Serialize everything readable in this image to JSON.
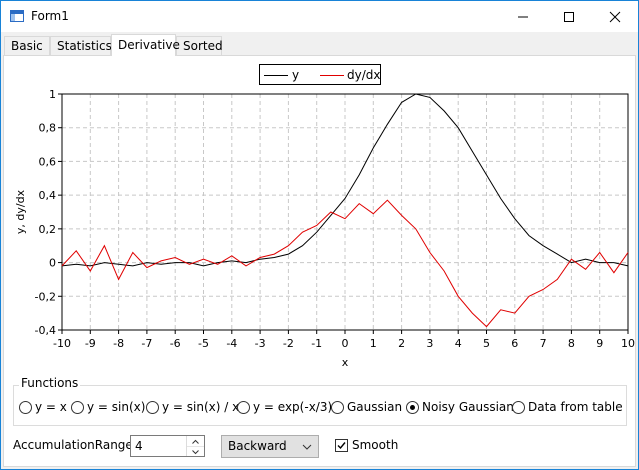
{
  "window": {
    "title": "Form1"
  },
  "tabs": [
    {
      "label": "Basic"
    },
    {
      "label": "Statistics"
    },
    {
      "label": "Derivative"
    },
    {
      "label": "Sorted"
    }
  ],
  "active_tab": "Derivative",
  "colors": {
    "y": "#000000",
    "dydx": "#e00000",
    "grid": "#c8c8c8",
    "accent": "#1883d7"
  },
  "chart_data": {
    "type": "line",
    "title": "",
    "xlabel": "x",
    "ylabel": "y, dy/dx",
    "xlim": [
      -10,
      10
    ],
    "ylim": [
      -0.4,
      1
    ],
    "x_ticks": [
      -10,
      -9,
      -8,
      -7,
      -6,
      -5,
      -4,
      -3,
      -2,
      -1,
      0,
      1,
      2,
      3,
      4,
      5,
      6,
      7,
      8,
      9,
      10
    ],
    "x_tick_labels": [
      "-10",
      "-9",
      "-8",
      "-7",
      "-6",
      "-5",
      "-4",
      "-3",
      "-2",
      "-1",
      "0",
      "1",
      "2",
      "3",
      "4",
      "5",
      "6",
      "7",
      "8",
      "9",
      "10"
    ],
    "y_ticks": [
      -0.4,
      -0.2,
      0,
      0.2,
      0.4,
      0.6,
      0.8,
      1
    ],
    "y_tick_labels": [
      "-0,4",
      "-0,2",
      "0",
      "0,2",
      "0,4",
      "0,6",
      "0,8",
      "1"
    ],
    "grid": true,
    "legend": "top-center",
    "x": [
      -10,
      -9.5,
      -9,
      -8.5,
      -8,
      -7.5,
      -7,
      -6.5,
      -6,
      -5.5,
      -5,
      -4.5,
      -4,
      -3.5,
      -3,
      -2.5,
      -2,
      -1.5,
      -1,
      -0.5,
      0,
      0.5,
      1,
      1.5,
      2,
      2.5,
      3,
      3.5,
      4,
      4.5,
      5,
      5.5,
      6,
      6.5,
      7,
      7.5,
      8,
      8.5,
      9,
      9.5,
      10
    ],
    "series": [
      {
        "name": "y",
        "values": [
          -0.02,
          -0.01,
          -0.02,
          0.0,
          -0.01,
          -0.02,
          0.0,
          -0.01,
          0.0,
          0.0,
          -0.02,
          0.0,
          0.01,
          0.0,
          0.02,
          0.03,
          0.05,
          0.1,
          0.18,
          0.28,
          0.38,
          0.52,
          0.68,
          0.82,
          0.95,
          1.0,
          0.98,
          0.9,
          0.8,
          0.66,
          0.52,
          0.38,
          0.26,
          0.16,
          0.1,
          0.05,
          0.0,
          0.02,
          0.0,
          0.0,
          -0.02
        ]
      },
      {
        "name": "dy/dx",
        "values": [
          -0.02,
          0.07,
          -0.05,
          0.1,
          -0.1,
          0.06,
          -0.03,
          0.01,
          0.03,
          -0.01,
          0.02,
          -0.01,
          0.04,
          -0.02,
          0.03,
          0.05,
          0.1,
          0.18,
          0.22,
          0.3,
          0.26,
          0.35,
          0.29,
          0.37,
          0.28,
          0.2,
          0.06,
          -0.05,
          -0.2,
          -0.3,
          -0.38,
          -0.28,
          -0.3,
          -0.2,
          -0.16,
          -0.1,
          0.02,
          -0.04,
          0.06,
          -0.06,
          0.06
        ]
      }
    ]
  },
  "functions": {
    "title": "Functions",
    "options": [
      {
        "label": "y = x",
        "selected": false
      },
      {
        "label": "y = sin(x)",
        "selected": false
      },
      {
        "label": "y = sin(x) / x",
        "selected": false
      },
      {
        "label": "y = exp(-x/3)",
        "selected": false
      },
      {
        "label": "Gaussian",
        "selected": false
      },
      {
        "label": "Noisy Gaussian",
        "selected": true
      },
      {
        "label": "Data from table",
        "selected": false
      }
    ]
  },
  "controls": {
    "accumulation_label": "AccumulationRange",
    "accumulation_value": "4",
    "direction_value": "Backward",
    "smooth_label": "Smooth",
    "smooth_checked": true
  }
}
